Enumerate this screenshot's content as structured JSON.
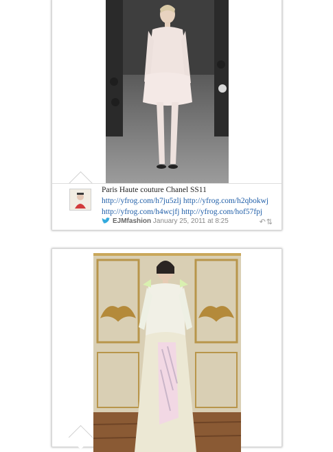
{
  "tweet": {
    "text_prefix": "Paris Haute couture Chanel SS11 ",
    "links": [
      "http://yfrog.com/h7ju5zlj",
      "http://yfrog.com/h2qbokwj",
      "http://yfrog.com/h4wcjfj",
      "http://yfrog.com/hof57fpj"
    ],
    "username": "EJMfashion",
    "timestamp": "January 25, 2011 at 8:25",
    "reply_icon": "reply-icon",
    "retweet_icon": "retweet-icon",
    "service_icon": "twitter-bird-icon"
  },
  "colors": {
    "link": "#1f5ea8",
    "meta": "#888888",
    "card_border": "#d6d6d6"
  }
}
